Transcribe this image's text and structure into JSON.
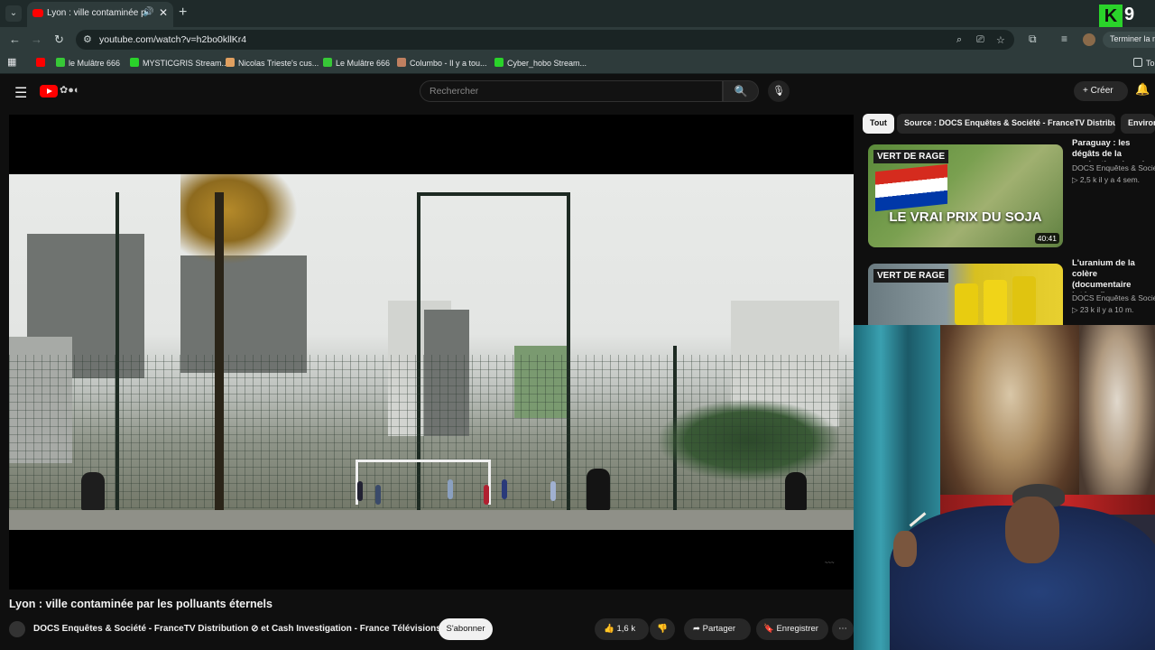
{
  "browser": {
    "tab": {
      "title": "Lyon : ville contaminée par",
      "close": "✕"
    },
    "new_tab": "+",
    "url": "youtube.com/watch?v=h2bo0kllKr4",
    "finish_button": "Terminer la m",
    "bookmarks": [
      {
        "label": "le Mulâtre 666",
        "color": "#37c837"
      },
      {
        "label": "MYSTICGRIS Stream...",
        "color": "#2ad32a"
      },
      {
        "label": "Nicolas Trieste's cus...",
        "color": "#e0a060"
      },
      {
        "label": "Le Mulâtre 666",
        "color": "#37c837"
      },
      {
        "label": "Columbo - Il y a tou...",
        "color": "#c08060"
      },
      {
        "label": "Cyber_hobo Stream...",
        "color": "#2ad32a"
      }
    ],
    "bookmarks_folder": "To"
  },
  "youtube": {
    "search_placeholder": "Rechercher",
    "create_label": "Créer",
    "video": {
      "title": "Lyon : ville contaminée par les polluants éternels",
      "channel": "DOCS Enquêtes & Société - FranceTV Distribution ⊘ et Cash Investigation - France Télévisions ⊘",
      "subscribe": "S'abonner",
      "likes": "1,6 k",
      "share": "Partager",
      "save": "Enregistrer",
      "more": "⋯"
    },
    "chips": [
      {
        "label": "Tout",
        "active": true
      },
      {
        "label": "Source : DOCS Enquêtes & Société - FranceTV Distribution",
        "active": false
      },
      {
        "label": "Environ",
        "active": false
      }
    ],
    "recommendations": [
      {
        "badge": "VERT DE RAGE",
        "overlay": "LE VRAI PRIX DU SOJA",
        "duration": "40:41",
        "title": "Paraguay : les dégâts de la production du soja",
        "channel": "DOCS Enquêtes & Société -",
        "meta": "▷ 2,5 k   il y a 4 sem."
      },
      {
        "badge": "VERT DE RAGE",
        "title": "L'uranium de la colère (documentaire intégral) rage",
        "channel": "DOCS Enquêtes & Société -",
        "meta": "▷ 23 k   il y a 10 m."
      }
    ]
  },
  "stream_logo": {
    "letter": "K",
    "number": "9"
  },
  "player": {
    "watermark": "~~~"
  },
  "colors": {
    "accent": "#ff0000",
    "bg": "#0f0f0f",
    "chip_active": "#f1f1f1"
  }
}
